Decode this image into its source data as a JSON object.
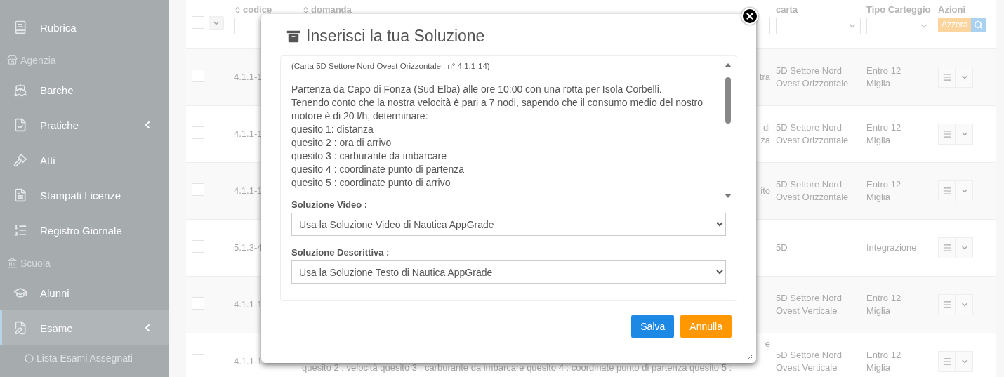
{
  "sidebar": {
    "items": [
      {
        "kind": "item",
        "label": "Rubrica",
        "selected": false,
        "submenu": false
      },
      {
        "kind": "header",
        "label": "Agenzia"
      },
      {
        "kind": "item",
        "label": "Barche",
        "selected": false,
        "submenu": false
      },
      {
        "kind": "item",
        "label": "Pratiche",
        "selected": false,
        "submenu": true
      },
      {
        "kind": "item",
        "label": "Atti",
        "selected": false,
        "submenu": false
      },
      {
        "kind": "item",
        "label": "Stampati Licenze",
        "selected": false,
        "submenu": false
      },
      {
        "kind": "item",
        "label": "Registro Giornale",
        "selected": false,
        "submenu": false
      },
      {
        "kind": "header",
        "label": "Scuola"
      },
      {
        "kind": "item",
        "label": "Alunni",
        "selected": false,
        "submenu": false
      },
      {
        "kind": "item",
        "label": "Esame",
        "selected": true,
        "submenu": true
      },
      {
        "kind": "subitem",
        "label": "Lista Esami Assegnati",
        "selected": false
      }
    ]
  },
  "table": {
    "select_all": {
      "checked": false
    },
    "columns": [
      {
        "kind": "input",
        "label": "codice",
        "sortable": true
      },
      {
        "kind": "input",
        "label": "domanda",
        "sortable": true
      },
      {
        "kind": "select",
        "label": "carta",
        "sortable": false
      },
      {
        "kind": "select",
        "label": "Tipo Carteggio",
        "sortable": false
      },
      {
        "kind": "actions",
        "label": "Azioni",
        "sortable": false,
        "button": "Azzera"
      }
    ],
    "rows": [
      {
        "checked": false,
        "codice": "4.1.1-1",
        "domanda": [
          "tra"
        ],
        "carta": "5D Settore Nord Ovest Orizzontale",
        "tipo": "Entro 12 Miglia"
      },
      {
        "checked": false,
        "codice": "4.1.1-1",
        "domanda": [
          "di",
          "za"
        ],
        "carta": "5D Settore Nord Ovest Orizzontale",
        "tipo": "Entro 12 Miglia"
      },
      {
        "checked": false,
        "codice": "4.1.1-1",
        "domanda": [
          "ito"
        ],
        "carta": "5D Settore Nord Ovest Orizzontale",
        "tipo": "Entro 12 Miglia"
      },
      {
        "checked": false,
        "codice": "5.1.3-4",
        "domanda": [],
        "carta": "5D",
        "tipo": "Integrazione"
      },
      {
        "checked": false,
        "codice": "4.1.1-1",
        "domanda": [],
        "carta": "5D Settore Nord Ovest Verticale",
        "tipo": "Entro 12 Miglia"
      },
      {
        "checked": false,
        "codice": "4.1.1-1",
        "domanda": [
          "e",
          "quesito 2 : velocità quesito 3 : carburante da imbarcare quesito 4 : coordinate punto di partenza quesito 5 :"
        ],
        "carta": "5D Settore Nord Ovest Verticale",
        "tipo": "Entro 12 Miglia"
      }
    ]
  },
  "modal": {
    "title": "Inserisci la tua Soluzione",
    "reference": "(Carta 5D Settore Nord Ovest Orizzontale : n° 4.1.1-14)",
    "question": [
      "Partenza da Capo di Fonza (Sud Elba) alle ore 10:00 con una rotta per Isola Corbelli.",
      "Tenendo conto che la nostra velocità è pari a 7 nodi, sapendo che il consumo medio del nostro motore è di 20 l/h, determinare:",
      "quesito 1: distanza",
      "quesito 2 : ora di arrivo",
      "quesito 3 : carburante da imbarcare",
      "quesito 4 : coordinate punto di partenza",
      "quesito 5 : coordinate punto di arrivo"
    ],
    "fields": [
      {
        "label": "Soluzione Video :",
        "value": "Usa la Soluzione Video di Nautica AppGrade"
      },
      {
        "label": "Soluzione Descrittiva :",
        "value": "Usa la Soluzione Testo di Nautica AppGrade"
      }
    ],
    "buttons": [
      {
        "kind": "primary",
        "label": "Salva"
      },
      {
        "kind": "warning",
        "label": "Annulla"
      }
    ]
  }
}
